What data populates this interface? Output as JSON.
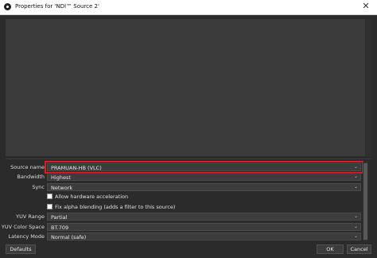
{
  "window": {
    "title": "Properties for 'NDI™ Source 2'",
    "close_glyph": "✕"
  },
  "fields": {
    "source_name": {
      "label": "Source name",
      "value": "PRAMUAN-HB (VLC)"
    },
    "bandwidth": {
      "label": "Bandwidth",
      "value": "Highest"
    },
    "sync": {
      "label": "Sync",
      "value": "Network"
    },
    "allow_hw": {
      "label": "Allow hardware acceleration",
      "checked": false
    },
    "fix_alpha": {
      "label": "Fix alpha blending (adds a filter to this source)",
      "checked": false
    },
    "yuv_range": {
      "label": "YUV Range",
      "value": "Partial"
    },
    "yuv_color_space": {
      "label": "YUV Color Space",
      "value": "BT.709"
    },
    "latency_mode": {
      "label": "Latency Mode",
      "value": "Normal (safe)"
    }
  },
  "buttons": {
    "defaults": "Defaults",
    "ok": "OK",
    "cancel": "Cancel"
  },
  "icons": {
    "dropdown": "chevron-down-icon",
    "app": "obs-logo-icon"
  },
  "colors": {
    "highlight": "#d32027",
    "background": "#2b2b2b"
  }
}
